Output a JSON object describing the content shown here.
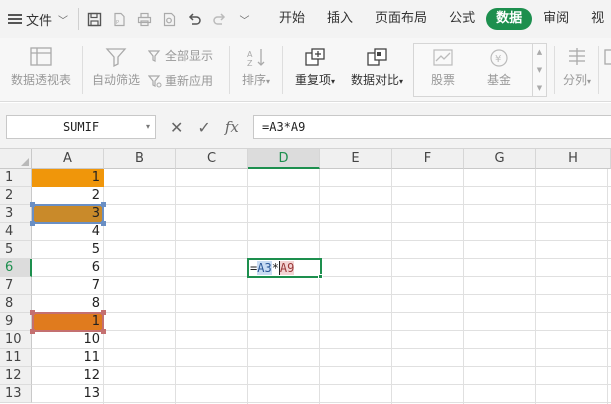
{
  "menu": {
    "file_label": "文件",
    "tabs": [
      {
        "label": "开始",
        "active": false
      },
      {
        "label": "插入",
        "active": false
      },
      {
        "label": "页面布局",
        "active": false
      },
      {
        "label": "公式",
        "active": false
      },
      {
        "label": "数据",
        "active": true
      },
      {
        "label": "审阅",
        "active": false
      },
      {
        "label": "视",
        "active": false
      }
    ]
  },
  "ribbon": {
    "pivot_label": "数据透视表",
    "autofilter_label": "自动筛选",
    "show_all_label": "全部显示",
    "reapply_label": "重新应用",
    "sort_label": "排序",
    "duplicates_label": "重复项",
    "compare_label": "数据对比",
    "stock_label": "股票",
    "fund_label": "基金",
    "split_label": "分列"
  },
  "formula_bar": {
    "name_box": "SUMIF",
    "formula": "=A3*A9",
    "fx_label": "fx"
  },
  "grid": {
    "columns": [
      "A",
      "B",
      "C",
      "D",
      "E",
      "F",
      "G",
      "H"
    ],
    "selected_column": "D",
    "rows": [
      "1",
      "2",
      "3",
      "4",
      "5",
      "6",
      "7",
      "8",
      "9",
      "10",
      "11",
      "12",
      "13"
    ],
    "selected_row": "6",
    "column_a_values": [
      "1",
      "2",
      "3",
      "4",
      "5",
      "6",
      "7",
      "8",
      "1",
      "10",
      "11",
      "12",
      "13"
    ],
    "editing_cell": {
      "address": "D6",
      "prefix": "=",
      "ref1": "A3",
      "operator": "*",
      "ref2": "A9"
    }
  },
  "colors": {
    "accent": "#1d8f4e",
    "a1_fill": "#f0960a",
    "a3_fill": "#c98a2a",
    "a9_fill": "#e07b1e",
    "ref1_border": "#6a8fc4",
    "ref2_border": "#c47070"
  }
}
